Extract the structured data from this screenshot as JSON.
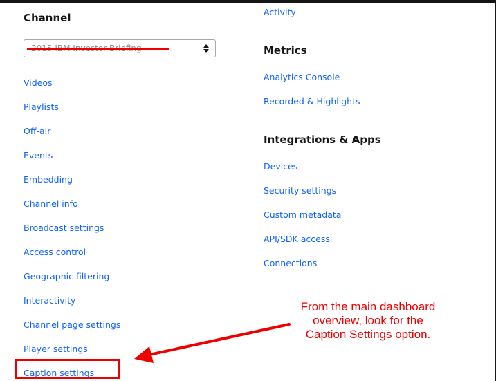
{
  "left_column": {
    "heading": "Channel",
    "channel_select": {
      "value": "2015 IBM Investor Briefing"
    },
    "links": [
      "Videos",
      "Playlists",
      "Off-air",
      "Events",
      "Embedding",
      "Channel info",
      "Broadcast settings",
      "Access control",
      "Geographic filtering",
      "Interactivity",
      "Channel page settings",
      "Player settings",
      "Caption settings"
    ]
  },
  "right_column": {
    "top_link": "Activity",
    "metrics": {
      "heading": "Metrics",
      "links": [
        "Analytics Console",
        "Recorded & Highlights"
      ]
    },
    "integrations": {
      "heading": "Integrations & Apps",
      "links": [
        "Devices",
        "Security settings",
        "Custom metadata",
        "API/SDK access",
        "Connections"
      ]
    }
  },
  "annotation": {
    "line1": "From the main dashboard",
    "line2": "overview, look for the",
    "line3": "Caption Settings option."
  },
  "colors": {
    "link": "#0f62fe",
    "heading": "#161616",
    "annotation": "#ee0000",
    "border": "#a8a8a8"
  }
}
